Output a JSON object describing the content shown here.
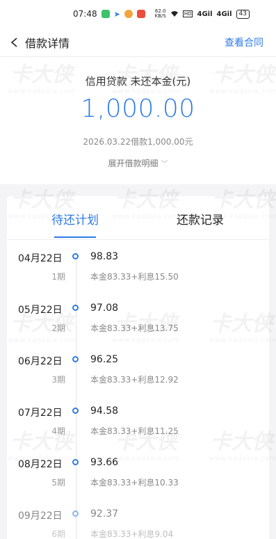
{
  "status_bar": {
    "time": "07:48",
    "network_speed": "62.0\nKB/S",
    "signal_1": "4Gil",
    "signal_2": "4Gil",
    "battery": "43"
  },
  "nav": {
    "title": "借款详情",
    "right_link": "查看合同"
  },
  "summary": {
    "label": "信用贷款 未还本金(元)",
    "amount": "1,000.00",
    "description": "2026.03.22借款1,000.00元",
    "toggle_label": "展开借款明细"
  },
  "tabs": [
    {
      "label": "待还计划",
      "active": true
    },
    {
      "label": "还款记录",
      "active": false
    }
  ],
  "schedule": [
    {
      "date": "04月22日",
      "amount": "98.83",
      "period": "1期",
      "detail": "本金83.33+利息15.50"
    },
    {
      "date": "05月22日",
      "amount": "97.08",
      "period": "2期",
      "detail": "本金83.33+利息13.75"
    },
    {
      "date": "06月22日",
      "amount": "96.25",
      "period": "3期",
      "detail": "本金83.33+利息12.92"
    },
    {
      "date": "07月22日",
      "amount": "94.58",
      "period": "4期",
      "detail": "本金83.33+利息11.25"
    },
    {
      "date": "08月22日",
      "amount": "93.66",
      "period": "5期",
      "detail": "本金83.33+利息10.33"
    },
    {
      "date": "09月22日",
      "amount": "92.37",
      "period": "6期",
      "detail": "本金83.33+利息9.04"
    }
  ],
  "watermark": {
    "brand": "卡大侠",
    "url": "www.kadaxia.com"
  },
  "colors": {
    "accent": "#2e7be6",
    "background": "#f4f4f6"
  }
}
